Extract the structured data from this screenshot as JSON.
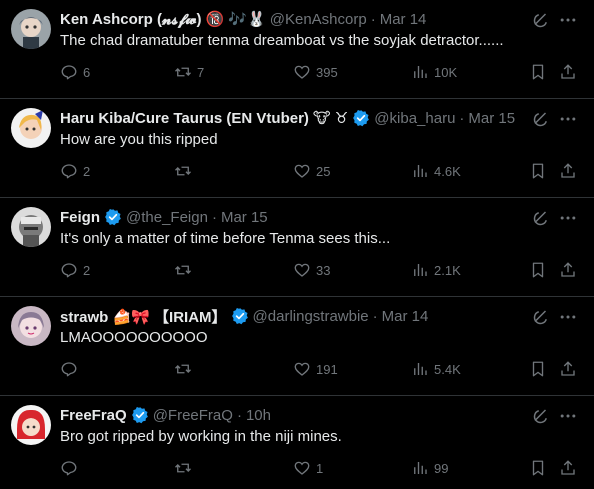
{
  "tweets": [
    {
      "name": "Ken Ashcorp (𝓷𝓼𝓯𝔀)",
      "emojis": "🔞 🎶🐰",
      "verified": false,
      "handle": "@KenAshcorp",
      "time": "Mar 14",
      "text": "The chad dramatuber tenma dreamboat vs the soyjak detractor......",
      "replies": "6",
      "retweets": "7",
      "likes": "395",
      "views": "10K"
    },
    {
      "name": "Haru Kiba/Cure Taurus (EN Vtuber)",
      "emojis": "🐮 ♉",
      "verified": true,
      "handle": "@kiba_haru",
      "time": "Mar 15",
      "text": "How are you this ripped",
      "replies": "2",
      "retweets": "",
      "likes": "25",
      "views": "4.6K"
    },
    {
      "name": "Feign",
      "emojis": "",
      "verified": true,
      "handle": "@the_Feign",
      "time": "Mar 15",
      "text": "It's only a matter of time before Tenma sees this...",
      "replies": "2",
      "retweets": "",
      "likes": "33",
      "views": "2.1K"
    },
    {
      "name": "strawb 🍰🎀 【IRIAM】",
      "emojis": "",
      "verified": true,
      "handle": "@darlingstrawbie",
      "time": "Mar 14",
      "text": "LMAOOOOOOOOOO",
      "replies": "",
      "retweets": "",
      "likes": "191",
      "views": "5.4K"
    },
    {
      "name": "FreeFraQ",
      "emojis": "",
      "verified": true,
      "handle": "@FreeFraQ",
      "time": "10h",
      "text": "Bro got ripped by working in the niji mines.",
      "replies": "",
      "retweets": "",
      "likes": "1",
      "views": "99"
    }
  ],
  "separator": "·",
  "colors": {
    "background": "#000000",
    "text": "#e7e9ea",
    "muted": "#71767b",
    "border": "#2f3336",
    "verified": "#1d9bf0"
  },
  "icons": [
    "reply-icon",
    "retweet-icon",
    "like-icon",
    "views-icon",
    "bookmark-icon",
    "share-icon",
    "grok-icon",
    "more-icon",
    "verified-badge-icon"
  ]
}
